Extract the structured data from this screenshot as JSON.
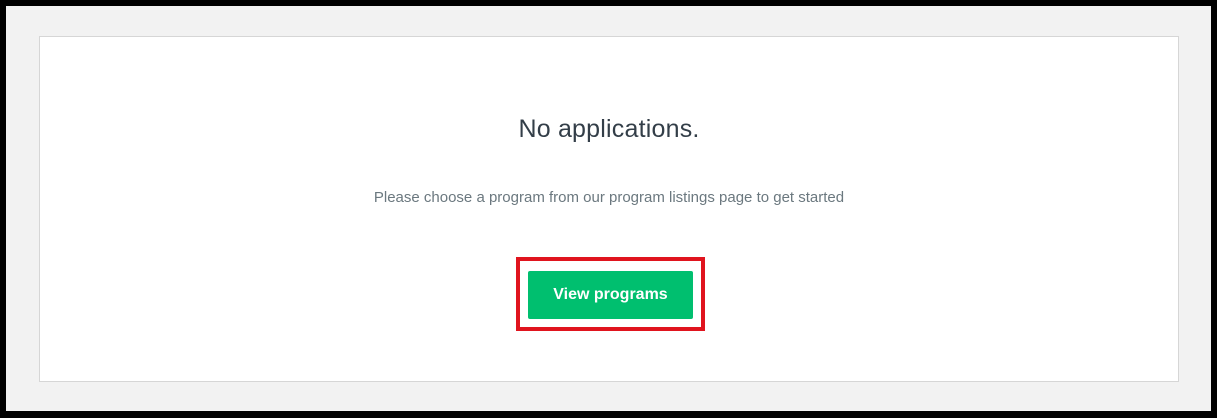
{
  "empty_state": {
    "title": "No applications.",
    "message": "Please choose a program from our program listings page to get started",
    "button_label": "View programs"
  },
  "colors": {
    "button_background": "#00bf6f",
    "highlight_border": "#e0141e",
    "title_text": "#333e48",
    "message_text": "#6b787f"
  }
}
